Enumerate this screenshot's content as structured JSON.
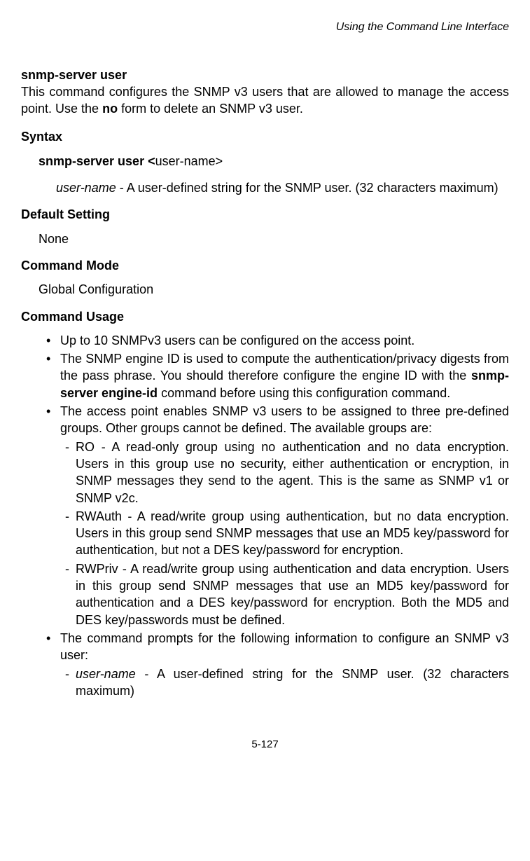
{
  "running_head": "Using the Command Line Interface",
  "cmd_title": "snmp-server user",
  "desc_pre": "This command configures the SNMP v3 users that are allowed to manage the access point. Use the ",
  "desc_bold": "no",
  "desc_post": " form to delete an SNMP v3 user.",
  "syntax_head": "Syntax",
  "syntax_bold": "snmp-server user <",
  "syntax_rest": "user-name>",
  "param_name": "user-name",
  "param_desc": " - A user-defined string for the SNMP user. (32 characters maximum)",
  "default_head": "Default Setting",
  "default_val": "None",
  "mode_head": "Command Mode",
  "mode_val": "Global Configuration",
  "usage_head": "Command Usage",
  "usage": {
    "u1": "Up to 10 SNMPv3 users can be configured on the access point.",
    "u2_pre": "The SNMP engine ID is used to compute the authentication/privacy digests from the pass phrase. You should therefore configure the engine ID with the ",
    "u2_bold": "snmp-server engine-id",
    "u2_post": " command before using this configuration command.",
    "u3": "The access point enables SNMP v3 users to be assigned to three pre-defined groups. Other groups cannot be defined. The available groups are:",
    "u3a": "RO - A read-only group using no authentication and no data encryption. Users in this group use no security, either authentication or encryption, in SNMP messages they send to the agent. This is the same as SNMP v1 or SNMP v2c.",
    "u3b": "RWAuth - A read/write group using authentication, but no data encryption. Users in this group send SNMP messages that use an MD5 key/password for authentication, but not a DES key/password for encryption.",
    "u3c": "RWPriv - A read/write group using authentication and data encryption. Users in this group send SNMP messages that use an MD5 key/password for authentication and a DES key/password for encryption. Both the MD5 and DES key/passwords must be defined.",
    "u4": "The command prompts for the following information to configure an SNMP v3 user:",
    "u4a_it": "user-name",
    "u4a_rest": " - A user-defined string for the SNMP user. (32 characters maximum)"
  },
  "page_num": "5-127"
}
